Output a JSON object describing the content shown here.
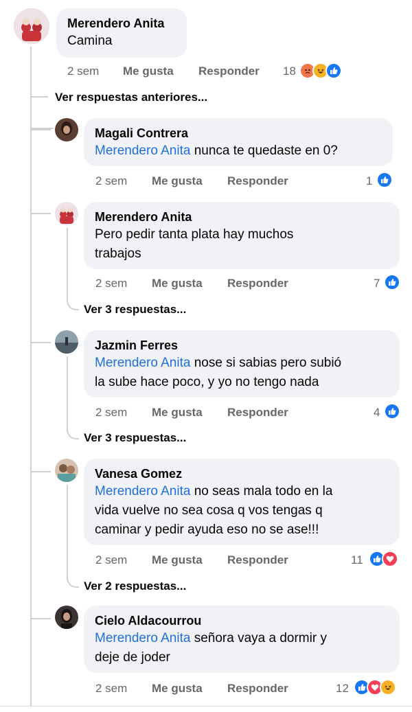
{
  "comments": [
    {
      "author": "Merendero Anita",
      "mention": "",
      "text": "Camina",
      "time": "2 sem",
      "like_label": "Me gusta",
      "reply_label": "Responder",
      "reaction_count": "18",
      "reactions": [
        "angry",
        "haha",
        "like"
      ]
    },
    {
      "author": "Magali Contrera",
      "mention": "Merendero Anita",
      "text": " nunca te quedaste en 0?",
      "time": "2 sem",
      "like_label": "Me gusta",
      "reply_label": "Responder",
      "reaction_count": "1",
      "reactions": [
        "like"
      ]
    },
    {
      "author": "Merendero Anita",
      "mention": "",
      "text_line1": "Pero pedir tanta plata  hay muchos",
      "text_line2": "trabajos",
      "time": "2 sem",
      "like_label": "Me gusta",
      "reply_label": "Responder",
      "reaction_count": "7",
      "reactions": [
        "like"
      ],
      "view_replies": "Ver 3 respuestas..."
    },
    {
      "author": "Jazmin Ferres",
      "mention": "Merendero Anita",
      "text_line1": " nose si sabias pero subió",
      "text_line2": "la sube hace poco, y yo no tengo nada",
      "time": "2 sem",
      "like_label": "Me gusta",
      "reply_label": "Responder",
      "reaction_count": "4",
      "reactions": [
        "like"
      ],
      "view_replies": "Ver 3 respuestas..."
    },
    {
      "author": "Vanesa Gomez",
      "mention": "Merendero Anita",
      "text_line1": " no seas mala todo en la",
      "text_line2": "vida vuelve no sea cosa q vos tengas q",
      "text_line3": "caminar y pedir ayuda eso no se ase!!!",
      "time": "2 sem",
      "like_label": "Me gusta",
      "reply_label": "Responder",
      "reaction_count": "11",
      "reactions": [
        "like",
        "love"
      ],
      "view_replies": "Ver 2 respuestas..."
    },
    {
      "author": "Cielo Aldacourrou",
      "mention": "Merendero Anita",
      "text_line1": " señora vaya a dormir y",
      "text_line2": "deje de joder",
      "time": "2 sem",
      "like_label": "Me gusta",
      "reply_label": "Responder",
      "reaction_count": "12",
      "reactions": [
        "like",
        "love",
        "haha"
      ]
    }
  ],
  "previous_replies_label": "Ver respuestas anteriores...",
  "colors": {
    "bubble": "#f0f2f5",
    "mention": "#216fdb",
    "meta": "#65676b",
    "like": "#1877f2",
    "love": "#f33e58",
    "haha": "#f7b125",
    "angry": "#f0764a"
  }
}
